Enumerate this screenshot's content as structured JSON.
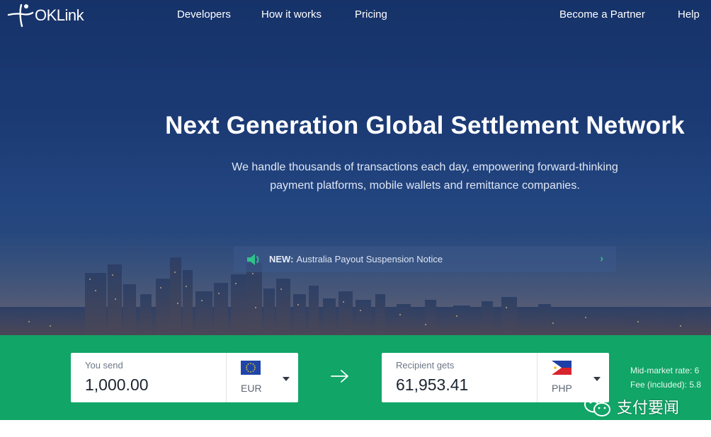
{
  "brand": {
    "name": "OKLink"
  },
  "nav": {
    "developers": "Developers",
    "how_it_works": "How it works",
    "pricing": "Pricing",
    "become_partner": "Become a Partner",
    "help": "Help"
  },
  "hero": {
    "headline": "Next Generation Global Settlement Network",
    "subline_1": "We handle thousands of transactions each day, empowering forward-thinking",
    "subline_2": "payment platforms, mobile wallets and remittance companies."
  },
  "notice": {
    "icon": "speaker-icon",
    "tag": "NEW:",
    "text": "Australia Payout Suspension Notice",
    "chevron": "›"
  },
  "converter": {
    "send": {
      "label": "You send",
      "amount": "1,000.00",
      "currency": "EUR",
      "flag": "eu-flag-icon"
    },
    "arrow": "arrow-right-icon",
    "receive": {
      "label": "Recipient gets",
      "amount": "61,953.41",
      "currency": "PHP",
      "flag": "ph-flag-icon"
    },
    "rate_label": "Mid-market rate: 6",
    "fee_label": "Fee (included): 5.8"
  },
  "watermark": {
    "text": "支付要闻"
  },
  "colors": {
    "hero_top": "#163269",
    "green": "#11a567",
    "notice_accent": "#2fc28a"
  }
}
